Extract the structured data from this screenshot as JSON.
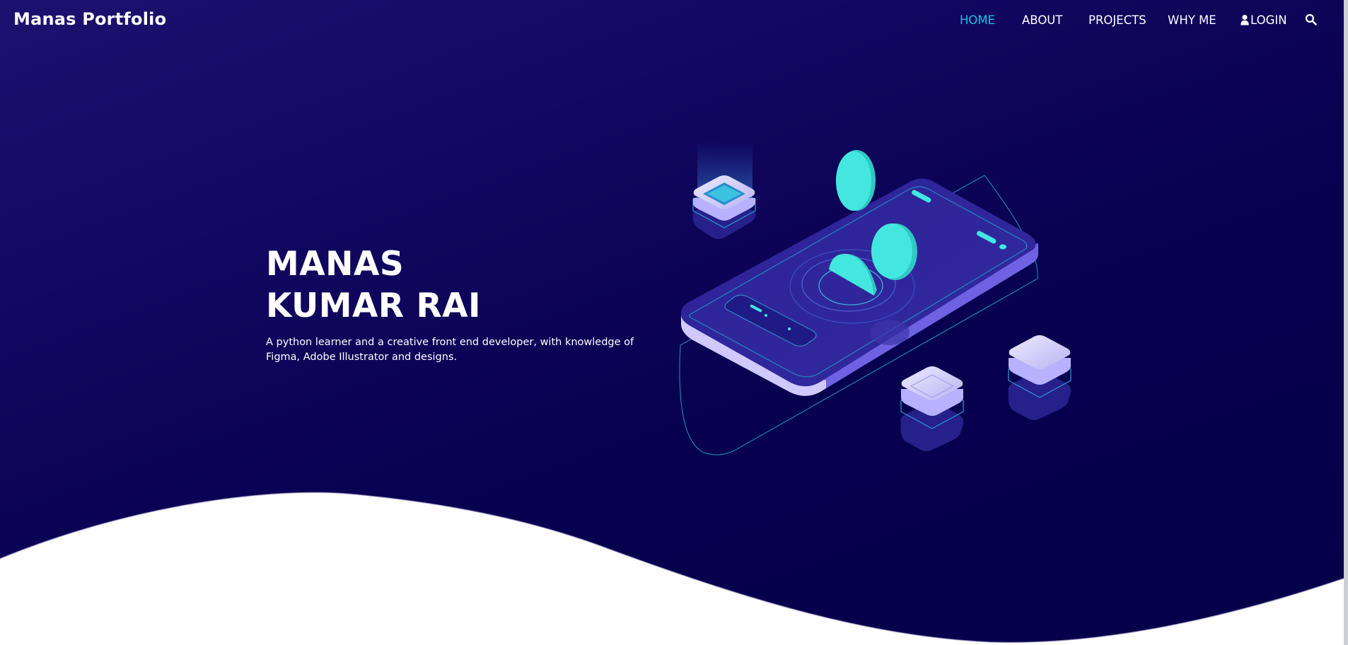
{
  "navbar": {
    "brand": "Manas Portfolio",
    "items": [
      {
        "label": "HOME",
        "active": true
      },
      {
        "label": "ABOUT",
        "active": false
      },
      {
        "label": "PROJECTS",
        "active": false
      },
      {
        "label": "WHY ME",
        "active": false
      },
      {
        "label": "LOGIN",
        "active": false,
        "icon": "user-icon"
      }
    ],
    "search_icon": "search-icon"
  },
  "hero": {
    "title_line1": "MANAS",
    "title_line2": "KUMAR RAI",
    "description": "A python learner and a creative front end developer, with knowledge of Figma, Adobe Illustrator and designs."
  },
  "colors": {
    "background_dark": "#07004f",
    "background_top": "#1d1170",
    "accent_active": "#17c2e6",
    "illustration_cyan": "#42e8e0",
    "illustration_purple": "#6c5fe0",
    "text": "#ffffff"
  }
}
